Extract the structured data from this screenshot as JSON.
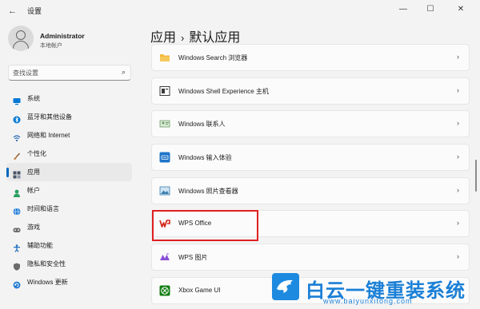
{
  "window": {
    "back_glyph": "←",
    "title": "设置",
    "minimize_glyph": "—",
    "maximize_glyph": "☐",
    "close_glyph": "✕"
  },
  "profile": {
    "name": "Administrator",
    "account_type": "本地帐户"
  },
  "search": {
    "placeholder": "查找设置",
    "icon": "search-icon",
    "glyph": "⌕"
  },
  "nav": {
    "items": [
      {
        "label": "系统",
        "icon": "monitor-icon",
        "color": "#0078d4"
      },
      {
        "label": "蓝牙和其他设备",
        "icon": "bluetooth-icon",
        "color": "#0078d4"
      },
      {
        "label": "网络和 Internet",
        "icon": "network-icon",
        "color": "#2b6cb0"
      },
      {
        "label": "个性化",
        "icon": "brush-icon",
        "color": "#c07a2c"
      },
      {
        "label": "应用",
        "icon": "apps-icon",
        "color": "#4a5568",
        "active": true
      },
      {
        "label": "帐户",
        "icon": "account-icon",
        "color": "#2aa061"
      },
      {
        "label": "时间和语言",
        "icon": "globe-icon",
        "color": "#1f7ad6"
      },
      {
        "label": "游戏",
        "icon": "game-icon",
        "color": "#6b6b6b"
      },
      {
        "label": "辅助功能",
        "icon": "accessibility-icon",
        "color": "#1f6fbf"
      },
      {
        "label": "隐私和安全性",
        "icon": "shield-icon",
        "color": "#6b6b6b"
      },
      {
        "label": "Windows 更新",
        "icon": "update-icon",
        "color": "#1f7ad6"
      }
    ]
  },
  "breadcrumb": {
    "parent": "应用",
    "separator": "›",
    "current": "默认应用"
  },
  "apps": {
    "rows": [
      {
        "name": "Windows Search 浏览器",
        "icon": "folder-icon",
        "color": "#f2b93b"
      },
      {
        "name": "Windows Shell Experience 主机",
        "icon": "shell-icon",
        "color": "#3a3a3a"
      },
      {
        "name": "Windows 联系人",
        "icon": "contacts-icon",
        "color": "#6b9a6b"
      },
      {
        "name": "Windows 输入体验",
        "icon": "keyboard-icon",
        "color": "#1f74c9"
      },
      {
        "name": "Windows 照片查看器",
        "icon": "photo-viewer-icon",
        "color": "#3c7fb0"
      },
      {
        "name": "WPS Office",
        "icon": "wps-office-icon",
        "color": "#d42a1e"
      },
      {
        "name": "WPS 图片",
        "icon": "wps-pictures-icon",
        "color": "#8a4fd6"
      },
      {
        "name": "Xbox Game UI",
        "icon": "xbox-icon",
        "color": "#107c10"
      }
    ],
    "chevron": "›"
  },
  "highlight_color": "#e02020",
  "watermark": {
    "text": "白云一键重装系统",
    "url": "www.baiyunxitong.com",
    "color": "#1a7fd6"
  }
}
